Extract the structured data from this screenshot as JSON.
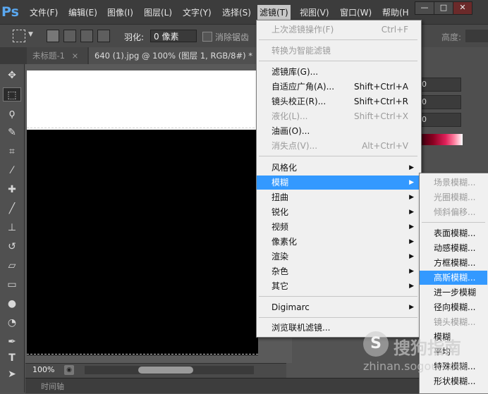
{
  "app": {
    "logo": "Ps"
  },
  "menubar": {
    "items": [
      "文件(F)",
      "编辑(E)",
      "图像(I)",
      "图层(L)",
      "文字(Y)",
      "选择(S)",
      "滤镜(T)",
      "视图(V)",
      "窗口(W)",
      "帮助(H"
    ],
    "active": "滤镜(T)"
  },
  "window_controls": {
    "minimize": "—",
    "maximize": "□",
    "close": "✕"
  },
  "options_bar": {
    "feather_label": "羽化:",
    "feather_value": "0 像素",
    "antialias_label": "消除锯齿",
    "height_label": "高度:"
  },
  "tabs": [
    {
      "label": "未标题-1",
      "close": "×",
      "active": false
    },
    {
      "label": "640 (1).jpg @ 100% (图层 1, RGB/8#) *",
      "close": "×",
      "active": true
    }
  ],
  "status": {
    "zoom": "100%",
    "timeline": "时间轴"
  },
  "right_panel": {
    "field_values": [
      "0",
      "0",
      "0"
    ]
  },
  "filter_menu": {
    "items": [
      {
        "label": "上次滤镜操作(F)",
        "shortcut": "Ctrl+F",
        "disabled": true
      },
      {
        "label": "转换为智能滤镜",
        "disabled": true
      },
      {
        "label": "滤镜库(G)..."
      },
      {
        "label": "自适应广角(A)...",
        "shortcut": "Shift+Ctrl+A"
      },
      {
        "label": "镜头校正(R)...",
        "shortcut": "Shift+Ctrl+R"
      },
      {
        "label": "液化(L)...",
        "shortcut": "Shift+Ctrl+X",
        "disabled": true
      },
      {
        "label": "油画(O)..."
      },
      {
        "label": "消失点(V)...",
        "shortcut": "Alt+Ctrl+V",
        "disabled": true
      },
      {
        "label": "风格化",
        "submenu": true
      },
      {
        "label": "模糊",
        "submenu": true,
        "highlighted": true
      },
      {
        "label": "扭曲",
        "submenu": true
      },
      {
        "label": "锐化",
        "submenu": true
      },
      {
        "label": "视频",
        "submenu": true
      },
      {
        "label": "像素化",
        "submenu": true
      },
      {
        "label": "渲染",
        "submenu": true
      },
      {
        "label": "杂色",
        "submenu": true
      },
      {
        "label": "其它",
        "submenu": true
      },
      {
        "label": "Digimarc",
        "submenu": true
      },
      {
        "label": "浏览联机滤镜..."
      }
    ]
  },
  "blur_submenu": {
    "items": [
      {
        "label": "场景模糊...",
        "disabled": true
      },
      {
        "label": "光圈模糊...",
        "disabled": true
      },
      {
        "label": "倾斜偏移...",
        "disabled": true
      },
      {
        "label": "表面模糊..."
      },
      {
        "label": "动感模糊..."
      },
      {
        "label": "方框模糊..."
      },
      {
        "label": "高斯模糊...",
        "highlighted": true
      },
      {
        "label": "进一步模糊"
      },
      {
        "label": "径向模糊..."
      },
      {
        "label": "镜头模糊...",
        "disabled": true
      },
      {
        "label": "模糊"
      },
      {
        "label": "平均"
      },
      {
        "label": "特殊模糊..."
      },
      {
        "label": "形状模糊..."
      }
    ]
  },
  "watermark": {
    "logo": "S",
    "text": "搜狗指南",
    "url": "zhinan.sogou.com"
  },
  "colors": {
    "menu_highlight": "#3399ff",
    "ps_blue": "#5aa8f0",
    "menu_bg": "#f0f0f0"
  }
}
